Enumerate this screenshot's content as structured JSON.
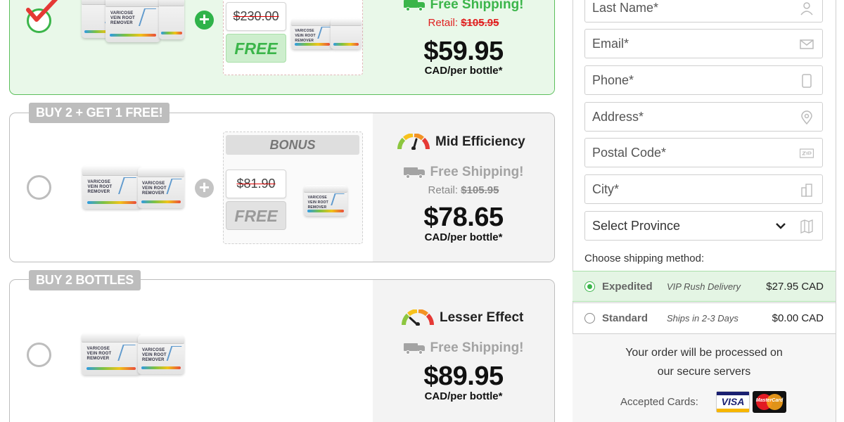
{
  "packages": [
    {
      "selected": true,
      "old_price": "$230.00",
      "free_label": "FREE",
      "shipping": "Free Shipping!",
      "retail_label": "Retail:",
      "retail_price": "$105.95",
      "price": "$59.95",
      "per": "CAD/per bottle*"
    },
    {
      "selected": false,
      "tab": "BUY 2 + GET 1 FREE!",
      "bonus": "BONUS",
      "old_price": "$81.90",
      "free_label": "FREE",
      "efficiency": "Mid Efficiency",
      "shipping": "Free Shipping!",
      "retail_label": "Retail:",
      "retail_price": "$105.95",
      "price": "$78.65",
      "per": "CAD/per bottle*"
    },
    {
      "selected": false,
      "tab": "BUY 2 BOTTLES",
      "efficiency": "Lesser Effect",
      "shipping": "Free Shipping!",
      "price": "$89.95",
      "per": "CAD/per bottle*"
    }
  ],
  "jar_label": "VARICOSE VEIN ROOT REMOVER",
  "form": {
    "last_name": "Last Name*",
    "email": "Email*",
    "phone": "Phone*",
    "address": "Address*",
    "postal": "Postal Code*",
    "city": "City*",
    "province": "Select Province"
  },
  "shipping": {
    "title": "Choose shipping method:",
    "methods": [
      {
        "name": "Expedited",
        "desc": "VIP Rush Delivery",
        "price": "$27.95 CAD",
        "selected": true
      },
      {
        "name": "Standard",
        "desc": "Ships in 2-3 Days",
        "price": "$0.00 CAD",
        "selected": false
      }
    ]
  },
  "secure": {
    "line1": "Your order will be processed on",
    "line2": "our secure servers",
    "cards_label": "Accepted Cards:",
    "visa": "VISA",
    "mastercard": "MasterCard"
  },
  "colors": {
    "accent_green": "#3bb54a",
    "retail_red": "#e02020",
    "tab_grey": "#bdbdbd"
  }
}
